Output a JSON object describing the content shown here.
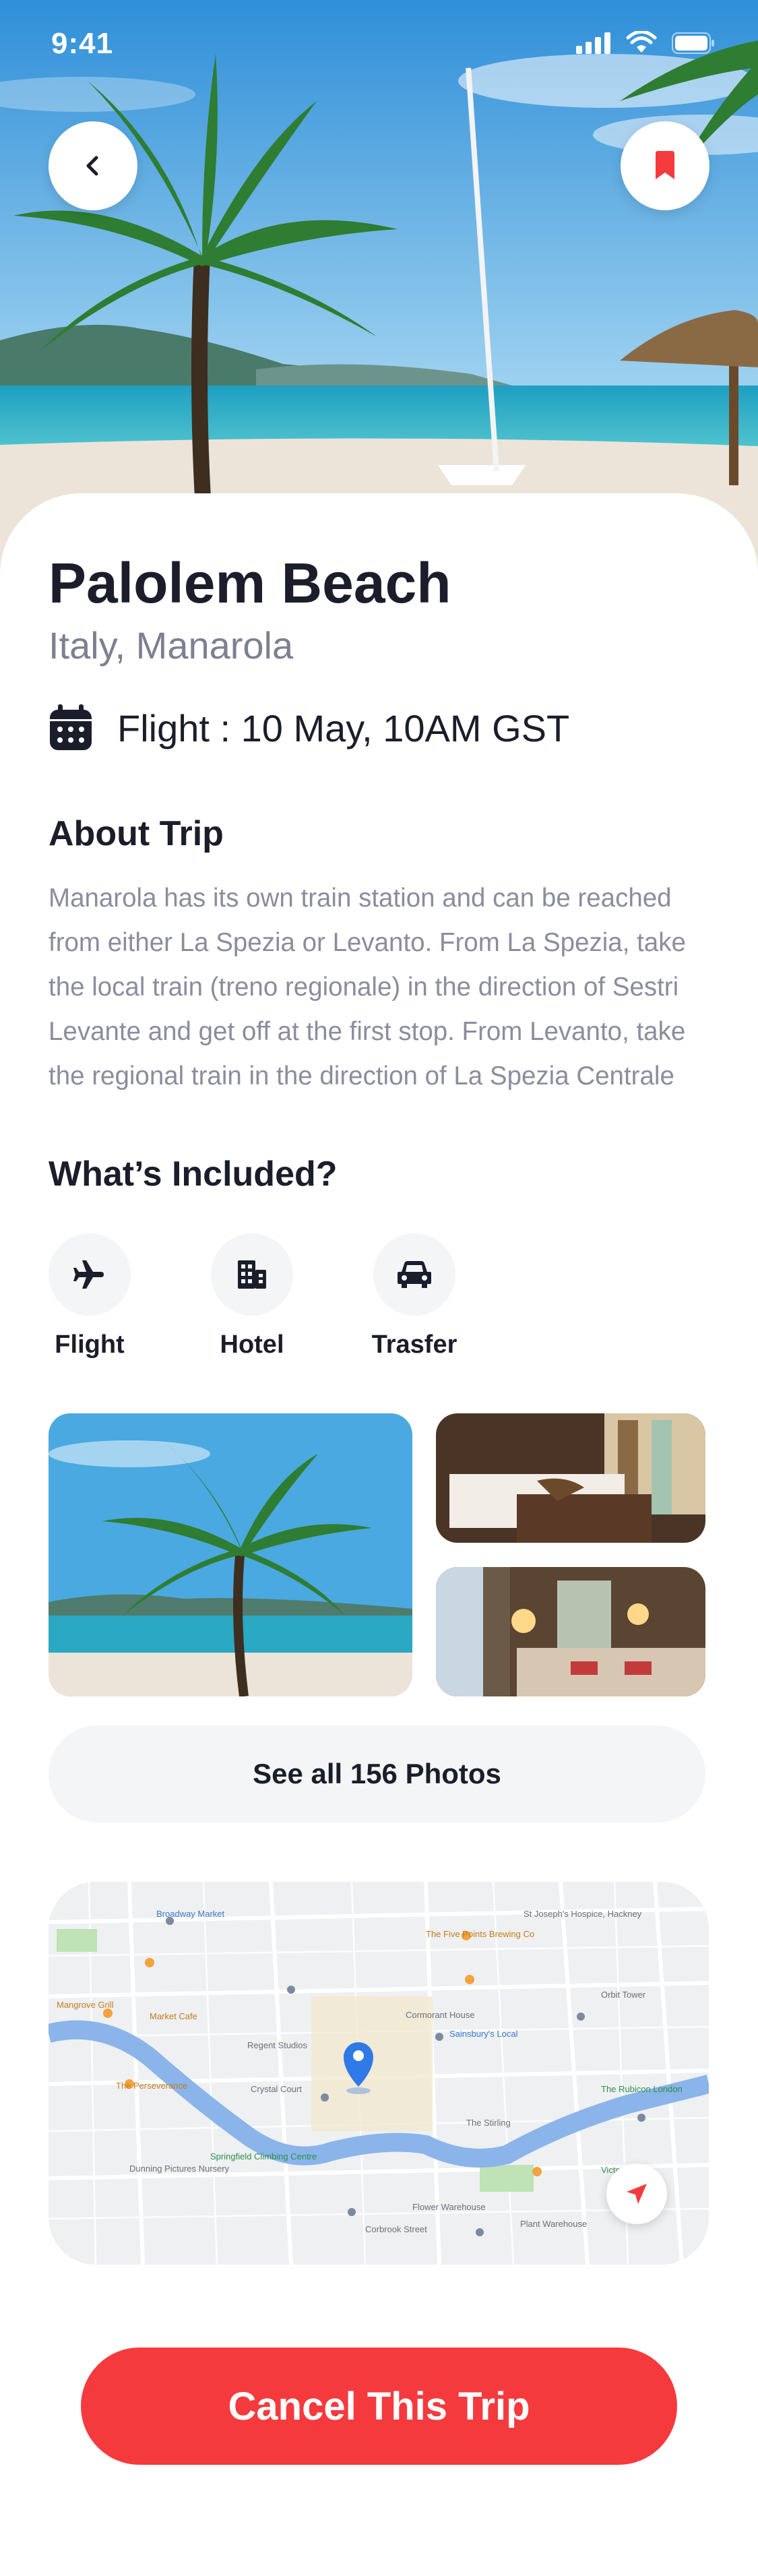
{
  "status_bar": {
    "time": "9:41"
  },
  "hero": {
    "back_icon": "chevron-left-icon",
    "bookmark_icon": "bookmark-icon",
    "bookmark_color": "#f53a3e"
  },
  "trip": {
    "title": "Palolem Beach",
    "location": "Italy, Manarola",
    "flight": "Flight : 10 May, 10AM GST"
  },
  "about": {
    "heading": "About Trip",
    "body": "Manarola has its own train station and can be reached from either La Spezia or Levanto. From La Spezia, take the local train (treno regionale) in the direction of Sestri Levante and get off at the first stop. From Levanto, take the regional train in the direction of La Spezia Centrale"
  },
  "included": {
    "heading": "What’s Included?",
    "items": [
      {
        "label": "Flight",
        "icon": "airplane-icon"
      },
      {
        "label": "Hotel",
        "icon": "building-icon"
      },
      {
        "label": "Trasfer",
        "icon": "car-icon"
      }
    ]
  },
  "photos": {
    "see_all_label": "See all 156 Photos"
  },
  "map": {
    "labels": [
      "Broadway Market",
      "St Joseph's Hospice, Hackney",
      "Market Cafe",
      "Regent Studios",
      "Crystal Court",
      "Corbrook Street",
      "The Stirling",
      "Flower Warehouse",
      "Plant Warehouse",
      "The Perseverance",
      "The Rubicon London",
      "Dunning Pictures Nursery",
      "Springfield Climbing Centre",
      "The Five Points Brewing Co",
      "Sainsbury's Local",
      "Cormorant House",
      "Orbit Tower",
      "Victoria Park",
      "Mangrove Grill"
    ]
  },
  "actions": {
    "cancel_label": "Cancel This Trip"
  },
  "colors": {
    "accent": "#f53a3e",
    "text": "#1b1e2a",
    "muted": "#7c8091",
    "chip": "#f4f5f7"
  }
}
